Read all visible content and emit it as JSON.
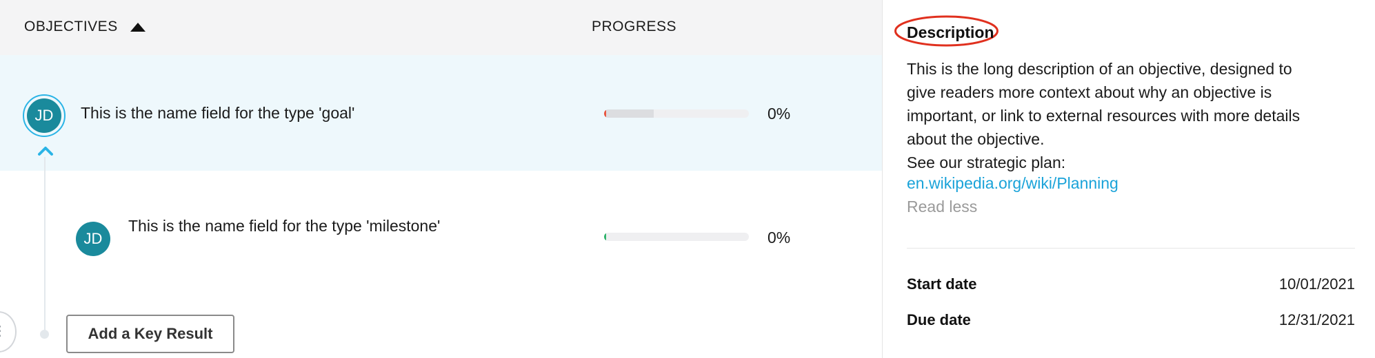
{
  "list": {
    "header": {
      "objectives_label": "OBJECTIVES",
      "sort_icon": "triangle-up-icon",
      "progress_label": "PROGRESS"
    },
    "items": [
      {
        "type": "goal",
        "avatar_initials": "JD",
        "name": "This is the name field for the type 'goal'",
        "progress": 0,
        "progress_text": "0%",
        "progress_color": "#e8553f",
        "selected": true
      },
      {
        "type": "milestone",
        "avatar_initials": "JD",
        "name": "This is the name field for the type 'milestone'",
        "progress": 0,
        "progress_text": "0%",
        "progress_color": "#2fb36b",
        "selected": false
      }
    ],
    "collapse_icon": "chevron-up-icon",
    "add_key_result_label": "Add a Key Result",
    "edge_handle_icon": "more-vertical-icon"
  },
  "detail": {
    "description_title": "Description",
    "description_lines": [
      "This is the long description of an objective, designed to",
      "give readers more context about why an objective is",
      "important, or link to external resources with more details",
      "about the objective.",
      "See our strategic plan:"
    ],
    "link_text": "en.wikipedia.org/wiki/Planning",
    "read_less_label": "Read less",
    "start_date_label": "Start date",
    "start_date_value": "10/01/2021",
    "due_date_label": "Due date",
    "due_date_value": "12/31/2021"
  },
  "colors": {
    "accent_blue": "#2ab4e6",
    "link_blue": "#1aa3d9",
    "avatar_teal": "#1a8a9c",
    "selected_row_bg": "#eef8fc",
    "header_bg": "#f4f4f5",
    "annotation_red": "#e0301e"
  }
}
